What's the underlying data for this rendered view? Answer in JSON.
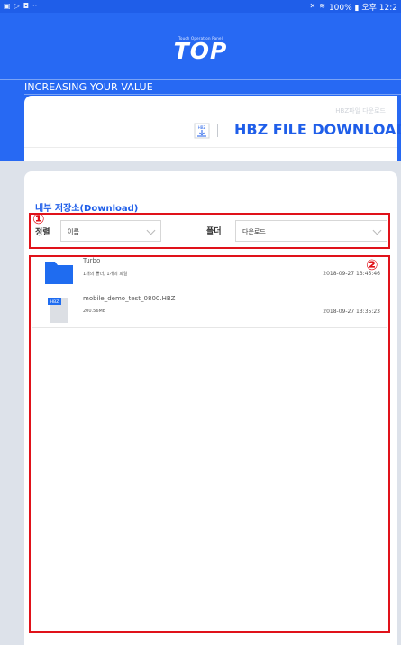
{
  "status": {
    "left_icons": [
      "image-icon",
      "play-store-icon",
      "video-icon",
      "more-icon"
    ],
    "text": "100% ▮ 오후 12:2"
  },
  "header": {
    "tagline": "Touch Operation Panel",
    "logo": "TOP",
    "slogan": "INCREASING YOUR VALUE"
  },
  "hbz": {
    "sub_label": "HBZ파일 다운로드",
    "icon_label": "HBZ",
    "title": "HBZ FILE DOWNLOAD"
  },
  "storage": {
    "title": "내부 저장소(Download)",
    "sort_label": "정렬",
    "sort_value": "이름",
    "folder_label": "폴더",
    "folder_value": "다운로드"
  },
  "annotations": {
    "one": "①",
    "two": "②"
  },
  "files": [
    {
      "icon": "folder-icon",
      "name": "Turbo",
      "meta": "1개의 폴더, 1개의 파일",
      "date": "2018-09-27 13:45:46"
    },
    {
      "icon": "hbz-file-icon",
      "badge": "HBZ",
      "name": "mobile_demo_test_0800.HBZ",
      "meta": "200.56MB",
      "date": "2018-09-27 13:35:23"
    }
  ],
  "colors": {
    "primary": "#2769f3",
    "accent_red": "#e0121a"
  }
}
